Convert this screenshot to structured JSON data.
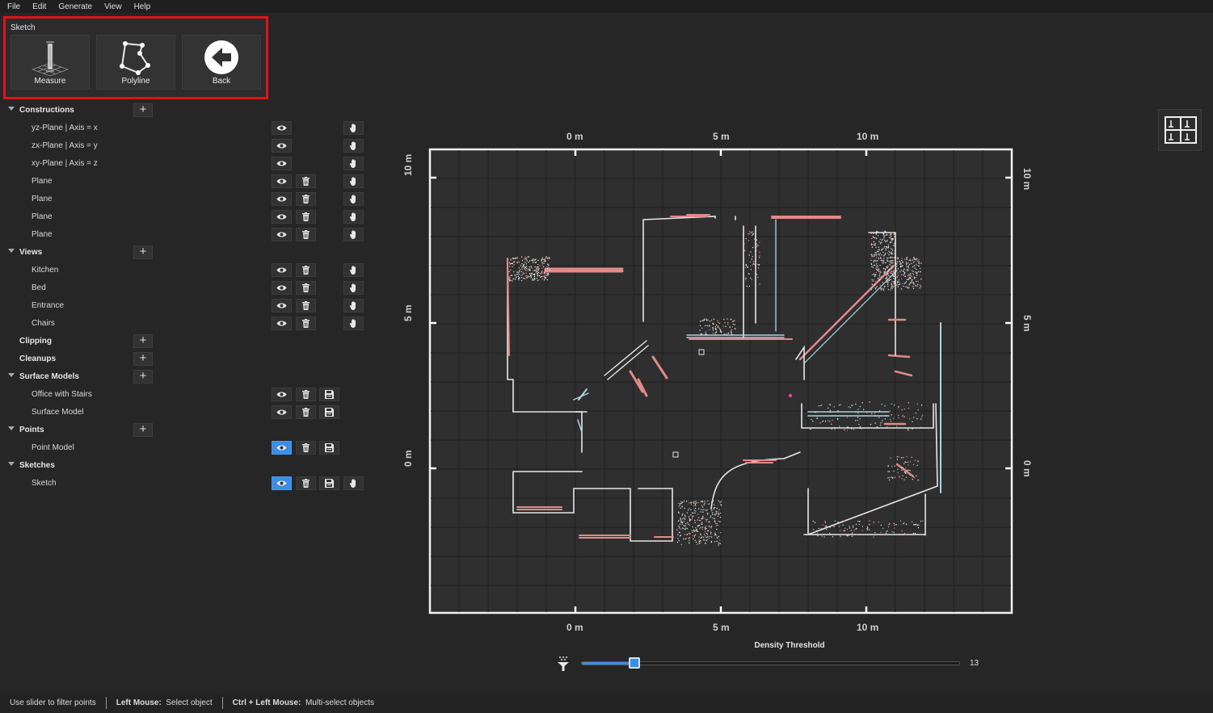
{
  "menu": [
    "File",
    "Edit",
    "Generate",
    "View",
    "Help"
  ],
  "sketch_toolbar": {
    "title": "Sketch",
    "tools": [
      {
        "label": "Measure",
        "icon": "measure-icon"
      },
      {
        "label": "Polyline",
        "icon": "polyline-icon"
      },
      {
        "label": "Back",
        "icon": "back-arrow-icon"
      }
    ]
  },
  "groups": {
    "constructions": {
      "title": "Constructions",
      "items": [
        {
          "label": "yz-Plane | Axis = x",
          "buttons": [
            "eye",
            "hand"
          ]
        },
        {
          "label": "zx-Plane | Axis = y",
          "buttons": [
            "eye",
            "hand"
          ]
        },
        {
          "label": "xy-Plane | Axis = z",
          "buttons": [
            "eye",
            "hand"
          ]
        },
        {
          "label": "Plane",
          "buttons": [
            "eye",
            "trash",
            "hand"
          ]
        },
        {
          "label": "Plane",
          "buttons": [
            "eye",
            "trash",
            "hand"
          ]
        },
        {
          "label": "Plane",
          "buttons": [
            "eye",
            "trash",
            "hand"
          ]
        },
        {
          "label": "Plane",
          "buttons": [
            "eye",
            "trash",
            "hand"
          ]
        }
      ]
    },
    "views": {
      "title": "Views",
      "items": [
        {
          "label": "Kitchen",
          "buttons": [
            "eye",
            "trash",
            "hand"
          ]
        },
        {
          "label": "Bed",
          "buttons": [
            "eye",
            "trash",
            "hand"
          ]
        },
        {
          "label": "Entrance",
          "buttons": [
            "eye",
            "trash",
            "hand"
          ]
        },
        {
          "label": "Chairs",
          "buttons": [
            "eye",
            "trash",
            "hand"
          ]
        }
      ]
    },
    "clipping": {
      "title": "Clipping"
    },
    "cleanups": {
      "title": "Cleanups"
    },
    "surface_models": {
      "title": "Surface Models",
      "items": [
        {
          "label": "Office with Stairs",
          "buttons": [
            "eye",
            "trash",
            "save"
          ]
        },
        {
          "label": "Surface Model",
          "buttons": [
            "eye",
            "trash",
            "save"
          ]
        }
      ]
    },
    "points": {
      "title": "Points",
      "items": [
        {
          "label": "Point Model",
          "buttons": [
            "eye-active",
            "trash",
            "save"
          ]
        }
      ]
    },
    "sketches": {
      "title": "Sketches",
      "items": [
        {
          "label": "Sketch",
          "buttons": [
            "eye-active",
            "trash",
            "save",
            "hand"
          ]
        }
      ]
    }
  },
  "map": {
    "top_ticks": [
      "0 m",
      "5 m",
      "10 m"
    ],
    "bottom_ticks": [
      "0 m",
      "5 m",
      "10 m"
    ],
    "left_ticks": [
      "10 m",
      "5 m",
      "0 m"
    ],
    "right_ticks": [
      "10 m",
      "5 m",
      "0 m"
    ]
  },
  "density": {
    "label": "Density Threshold",
    "value": "13",
    "fraction": 0.14
  },
  "status": {
    "hint": "Use slider to filter points",
    "left_mouse_key": "Left Mouse:",
    "left_mouse_action": "Select object",
    "ctrl_key": "Ctrl + Left Mouse:",
    "ctrl_action": "Multi-select objects"
  },
  "colors": {
    "accent": "#3a8ee6",
    "highlight_border": "#e0131a"
  }
}
